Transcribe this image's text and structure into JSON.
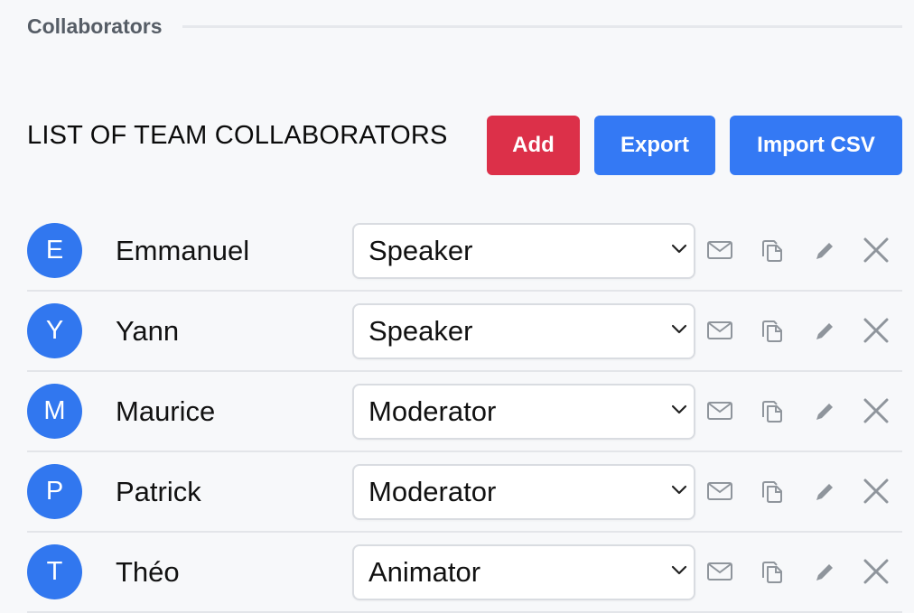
{
  "section": {
    "label": "Collaborators"
  },
  "toolbar": {
    "title": "LIST OF TEAM COLLABORATORS",
    "add_label": "Add",
    "export_label": "Export",
    "import_label": "Import CSV"
  },
  "colors": {
    "add": "#dc3049",
    "primary": "#3479f4",
    "avatar": "#3177ef",
    "icon": "#8f959c"
  },
  "icons": [
    "mail-icon",
    "duplicate-icon",
    "pencil-icon",
    "close-icon",
    "chevron-down-icon"
  ],
  "collaborators": [
    {
      "initial": "E",
      "name": "Emmanuel",
      "role": "Speaker"
    },
    {
      "initial": "Y",
      "name": "Yann",
      "role": "Speaker"
    },
    {
      "initial": "M",
      "name": "Maurice",
      "role": "Moderator"
    },
    {
      "initial": "P",
      "name": "Patrick",
      "role": "Moderator"
    },
    {
      "initial": "T",
      "name": "Théo",
      "role": "Animator"
    }
  ]
}
